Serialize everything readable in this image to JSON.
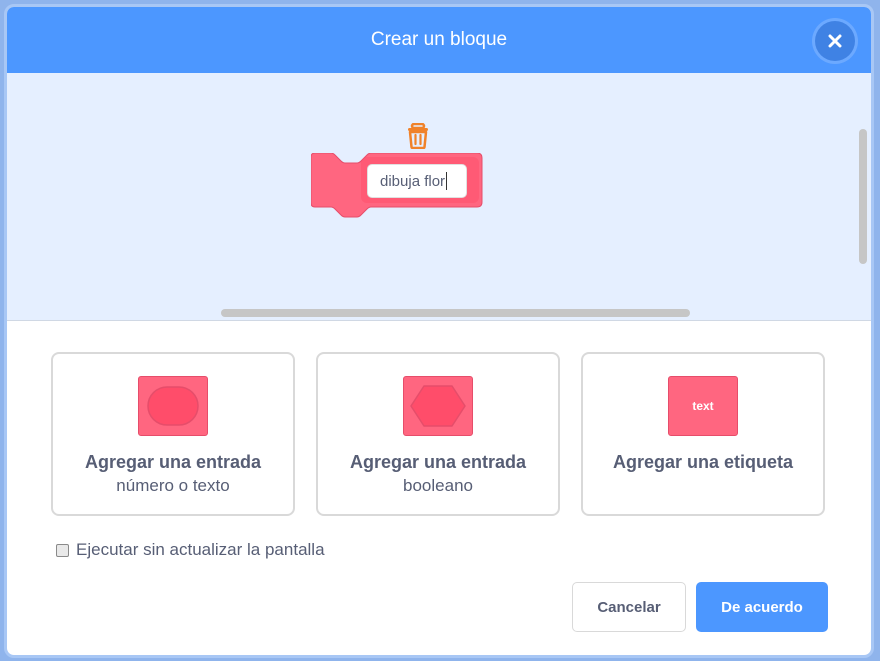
{
  "dialog": {
    "title": "Crear un bloque",
    "close_icon": "close-icon"
  },
  "workspace": {
    "block_name_value": "dibuja flor",
    "block_color": "#ff6680",
    "delete_icon": "trash-icon"
  },
  "options": [
    {
      "title": "Agregar una entrada",
      "subtitle": "número o texto",
      "icon": "round-input-icon"
    },
    {
      "title": "Agregar una entrada",
      "subtitle": "booleano",
      "icon": "boolean-input-icon"
    },
    {
      "title": "Agregar una etiqueta",
      "subtitle": "",
      "icon_text": "text"
    }
  ],
  "run_without_refresh": {
    "label": "Ejecutar sin actualizar la pantalla",
    "checked": false
  },
  "buttons": {
    "cancel_label": "Cancelar",
    "ok_label": "De acuerdo"
  },
  "colors": {
    "header": "#4c97ff",
    "workspace_bg": "#e5efff",
    "block": "#ff6680",
    "text": "#575e75"
  }
}
